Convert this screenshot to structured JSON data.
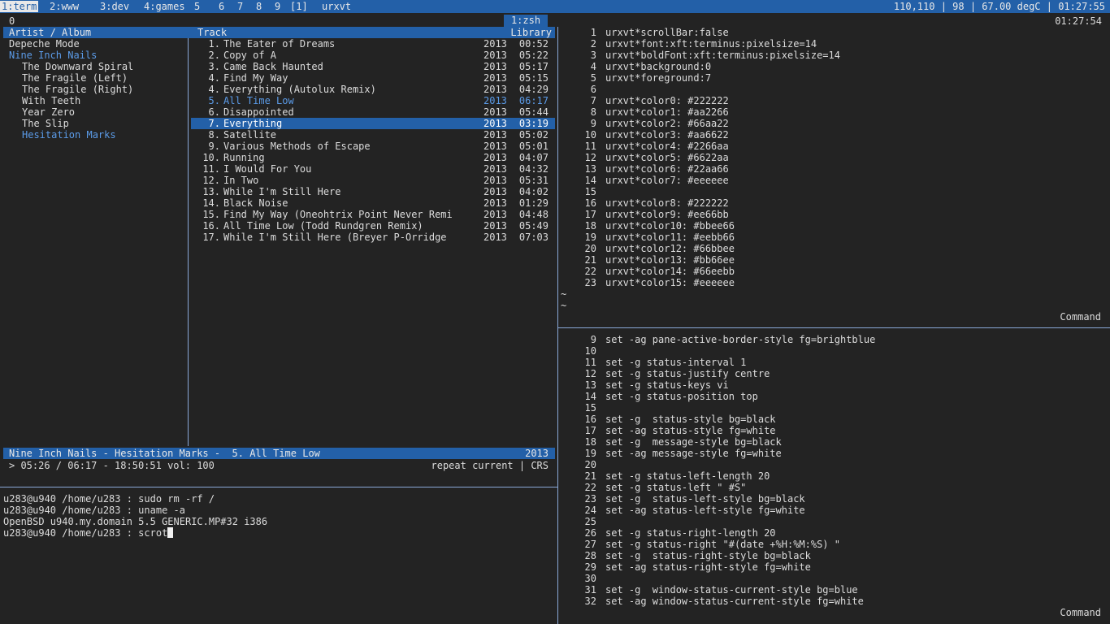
{
  "topbar": {
    "workspaces": [
      {
        "label": "1:term",
        "active": true
      },
      {
        "label": "2:www",
        "active": false
      },
      {
        "label": "3:dev",
        "active": false
      },
      {
        "label": "4:games",
        "active": false
      },
      {
        "label": "5",
        "active": false
      },
      {
        "label": "6",
        "active": false
      },
      {
        "label": "7",
        "active": false
      },
      {
        "label": "8",
        "active": false
      },
      {
        "label": "9",
        "active": false
      }
    ],
    "layout": "[1]",
    "window_title": "urxvt",
    "status": "110,110 | 98 | 67.00 degC | 01:27:55"
  },
  "tmux": {
    "index": "0",
    "window": "1:zsh",
    "clock": "01:27:54"
  },
  "player": {
    "headers": {
      "artist_album": "Artist / Album",
      "track": "Track",
      "library": "Library"
    },
    "artists": [
      {
        "label": "Depeche Mode",
        "indent": false,
        "highlight": false
      },
      {
        "label": "Nine Inch Nails",
        "indent": false,
        "highlight": true
      },
      {
        "label": "The Downward Spiral",
        "indent": true,
        "highlight": false
      },
      {
        "label": "The Fragile (Left)",
        "indent": true,
        "highlight": false
      },
      {
        "label": "The Fragile (Right)",
        "indent": true,
        "highlight": false
      },
      {
        "label": "With Teeth",
        "indent": true,
        "highlight": false
      },
      {
        "label": "Year Zero",
        "indent": true,
        "highlight": false
      },
      {
        "label": "The Slip",
        "indent": true,
        "highlight": false
      },
      {
        "label": "Hesitation Marks",
        "indent": true,
        "highlight": true
      }
    ],
    "tracks": [
      {
        "num": "1.",
        "title": "The Eater of Dreams",
        "year": "2013",
        "dur": "00:52"
      },
      {
        "num": "2.",
        "title": "Copy of A",
        "year": "2013",
        "dur": "05:22"
      },
      {
        "num": "3.",
        "title": "Came Back Haunted",
        "year": "2013",
        "dur": "05:17"
      },
      {
        "num": "4.",
        "title": "Find My Way",
        "year": "2013",
        "dur": "05:15"
      },
      {
        "num": "4.",
        "title": "Everything (Autolux Remix)",
        "year": "2013",
        "dur": "04:29"
      },
      {
        "num": "5.",
        "title": "All Time Low",
        "year": "2013",
        "dur": "06:17",
        "playing": true
      },
      {
        "num": "6.",
        "title": "Disappointed",
        "year": "2013",
        "dur": "05:44"
      },
      {
        "num": "7.",
        "title": "Everything",
        "year": "2013",
        "dur": "03:19",
        "selected": true
      },
      {
        "num": "8.",
        "title": "Satellite",
        "year": "2013",
        "dur": "05:02"
      },
      {
        "num": "9.",
        "title": "Various Methods of Escape",
        "year": "2013",
        "dur": "05:01"
      },
      {
        "num": "10.",
        "title": "Running",
        "year": "2013",
        "dur": "04:07"
      },
      {
        "num": "11.",
        "title": "I Would For You",
        "year": "2013",
        "dur": "04:32"
      },
      {
        "num": "12.",
        "title": "In Two",
        "year": "2013",
        "dur": "05:31"
      },
      {
        "num": "13.",
        "title": "While I'm Still Here",
        "year": "2013",
        "dur": "04:02"
      },
      {
        "num": "14.",
        "title": "Black Noise",
        "year": "2013",
        "dur": "01:29"
      },
      {
        "num": "15.",
        "title": "Find My Way (Oneohtrix Point Never Remi",
        "year": "2013",
        "dur": "04:48"
      },
      {
        "num": "16.",
        "title": "All Time Low (Todd Rundgren Remix)",
        "year": "2013",
        "dur": "05:49"
      },
      {
        "num": "17.",
        "title": "While I'm Still Here (Breyer P-Orridge",
        "year": "2013",
        "dur": "07:03"
      }
    ],
    "now_playing": "Nine Inch Nails - Hesitation Marks -  5. All Time Low",
    "now_playing_year": "2013",
    "progress": "> 05:26 / 06:17 - 18:50:51 vol: 100",
    "mode": "repeat current | CRS"
  },
  "shell": {
    "lines": [
      "u283@u940 /home/u283 : sudo rm -rf /",
      "u283@u940 /home/u283 : uname -a",
      "OpenBSD u940.my.domain 5.5 GENERIC.MP#32 i386"
    ],
    "prompt": "u283@u940 /home/u283 : scrot"
  },
  "editor_top": {
    "lines": [
      {
        "n": "1",
        "t": "urxvt*scrollBar:false"
      },
      {
        "n": "2",
        "t": "urxvt*font:xft:terminus:pixelsize=14"
      },
      {
        "n": "3",
        "t": "urxvt*boldFont:xft:terminus:pixelsize=14"
      },
      {
        "n": "4",
        "t": "urxvt*background:0"
      },
      {
        "n": "5",
        "t": "urxvt*foreground:7"
      },
      {
        "n": "6",
        "t": ""
      },
      {
        "n": "7",
        "t": "urxvt*color0: #222222"
      },
      {
        "n": "8",
        "t": "urxvt*color1: #aa2266"
      },
      {
        "n": "9",
        "t": "urxvt*color2: #66aa22"
      },
      {
        "n": "10",
        "t": "urxvt*color3: #aa6622"
      },
      {
        "n": "11",
        "t": "urxvt*color4: #2266aa"
      },
      {
        "n": "12",
        "t": "urxvt*color5: #6622aa"
      },
      {
        "n": "13",
        "t": "urxvt*color6: #22aa66"
      },
      {
        "n": "14",
        "t": "urxvt*color7: #eeeeee"
      },
      {
        "n": "15",
        "t": ""
      },
      {
        "n": "16",
        "t": "urxvt*color8: #222222"
      },
      {
        "n": "17",
        "t": "urxvt*color9: #ee66bb"
      },
      {
        "n": "18",
        "t": "urxvt*color10: #bbee66"
      },
      {
        "n": "19",
        "t": "urxvt*color11: #eebb66"
      },
      {
        "n": "20",
        "t": "urxvt*color12: #66bbee"
      },
      {
        "n": "21",
        "t": "urxvt*color13: #bb66ee"
      },
      {
        "n": "22",
        "t": "urxvt*color14: #66eebb"
      },
      {
        "n": "23",
        "t": "urxvt*color15: #eeeeee"
      }
    ],
    "tildes": [
      "~",
      "~"
    ],
    "mode": "Command"
  },
  "editor_bottom": {
    "lines": [
      {
        "n": "9",
        "t": "set -ag pane-active-border-style fg=brightblue"
      },
      {
        "n": "10",
        "t": ""
      },
      {
        "n": "11",
        "t": "set -g status-interval 1"
      },
      {
        "n": "12",
        "t": "set -g status-justify centre"
      },
      {
        "n": "13",
        "t": "set -g status-keys vi"
      },
      {
        "n": "14",
        "t": "set -g status-position top"
      },
      {
        "n": "15",
        "t": ""
      },
      {
        "n": "16",
        "t": "set -g  status-style bg=black"
      },
      {
        "n": "17",
        "t": "set -ag status-style fg=white"
      },
      {
        "n": "18",
        "t": "set -g  message-style bg=black"
      },
      {
        "n": "19",
        "t": "set -ag message-style fg=white"
      },
      {
        "n": "20",
        "t": ""
      },
      {
        "n": "21",
        "t": "set -g status-left-length 20"
      },
      {
        "n": "22",
        "t": "set -g status-left \" #S\""
      },
      {
        "n": "23",
        "t": "set -g  status-left-style bg=black"
      },
      {
        "n": "24",
        "t": "set -ag status-left-style fg=white"
      },
      {
        "n": "25",
        "t": ""
      },
      {
        "n": "26",
        "t": "set -g status-right-length 20"
      },
      {
        "n": "27",
        "t": "set -g status-right \"#(date +%H:%M:%S) \""
      },
      {
        "n": "28",
        "t": "set -g  status-right-style bg=black"
      },
      {
        "n": "29",
        "t": "set -ag status-right-style fg=white"
      },
      {
        "n": "30",
        "t": ""
      },
      {
        "n": "31",
        "t": "set -g  window-status-current-style bg=blue"
      },
      {
        "n": "32",
        "t": "set -ag window-status-current-style fg=white"
      }
    ],
    "mode": "Command"
  },
  "colors": {
    "accent": "#2360a8",
    "highlight_text": "#5b9be8",
    "background": "#232323",
    "foreground": "#dcdcdc",
    "border": "#8aa8d8"
  }
}
